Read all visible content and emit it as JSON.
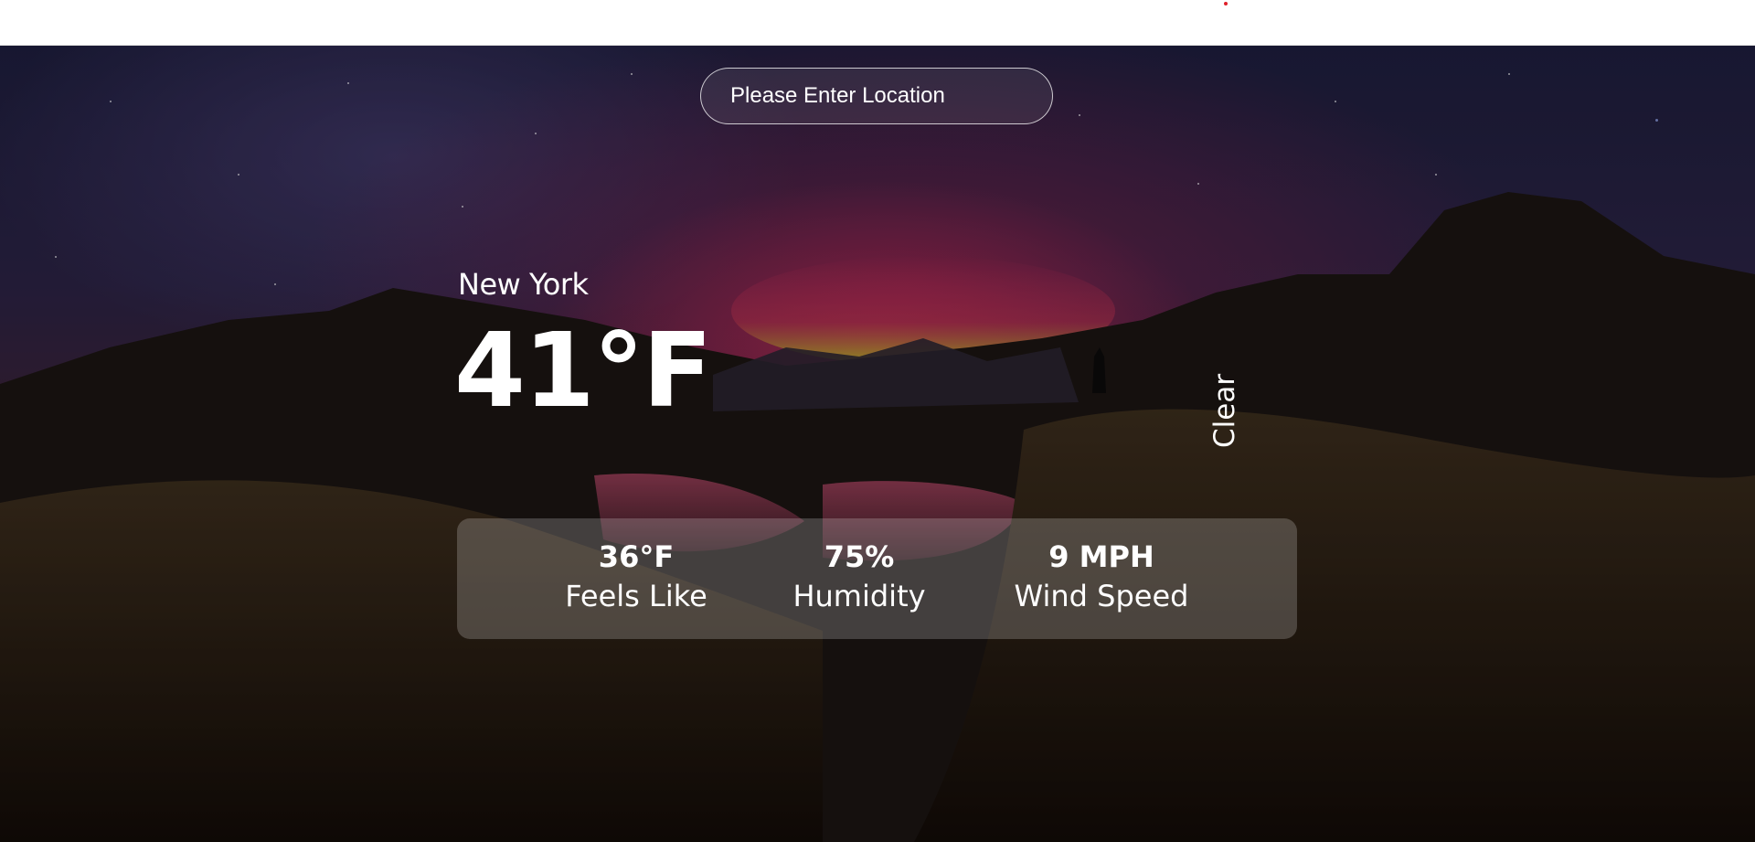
{
  "search": {
    "placeholder": "Please Enter Location",
    "value": ""
  },
  "weather": {
    "city": "New York",
    "temperature": "41°F",
    "condition": "Clear"
  },
  "stats": {
    "feels_like": {
      "value": "36°F",
      "label": "Feels Like"
    },
    "humidity": {
      "value": "75%",
      "label": "Humidity"
    },
    "wind_speed": {
      "value": "9 MPH",
      "label": "Wind Speed"
    }
  },
  "colors": {
    "text": "#ffffff",
    "panel": "rgba(255,255,255,0.2)",
    "aurora_red": "#ae284e",
    "aurora_green": "#a8c81e"
  },
  "icons": {
    "notification": "red-dot-icon"
  }
}
